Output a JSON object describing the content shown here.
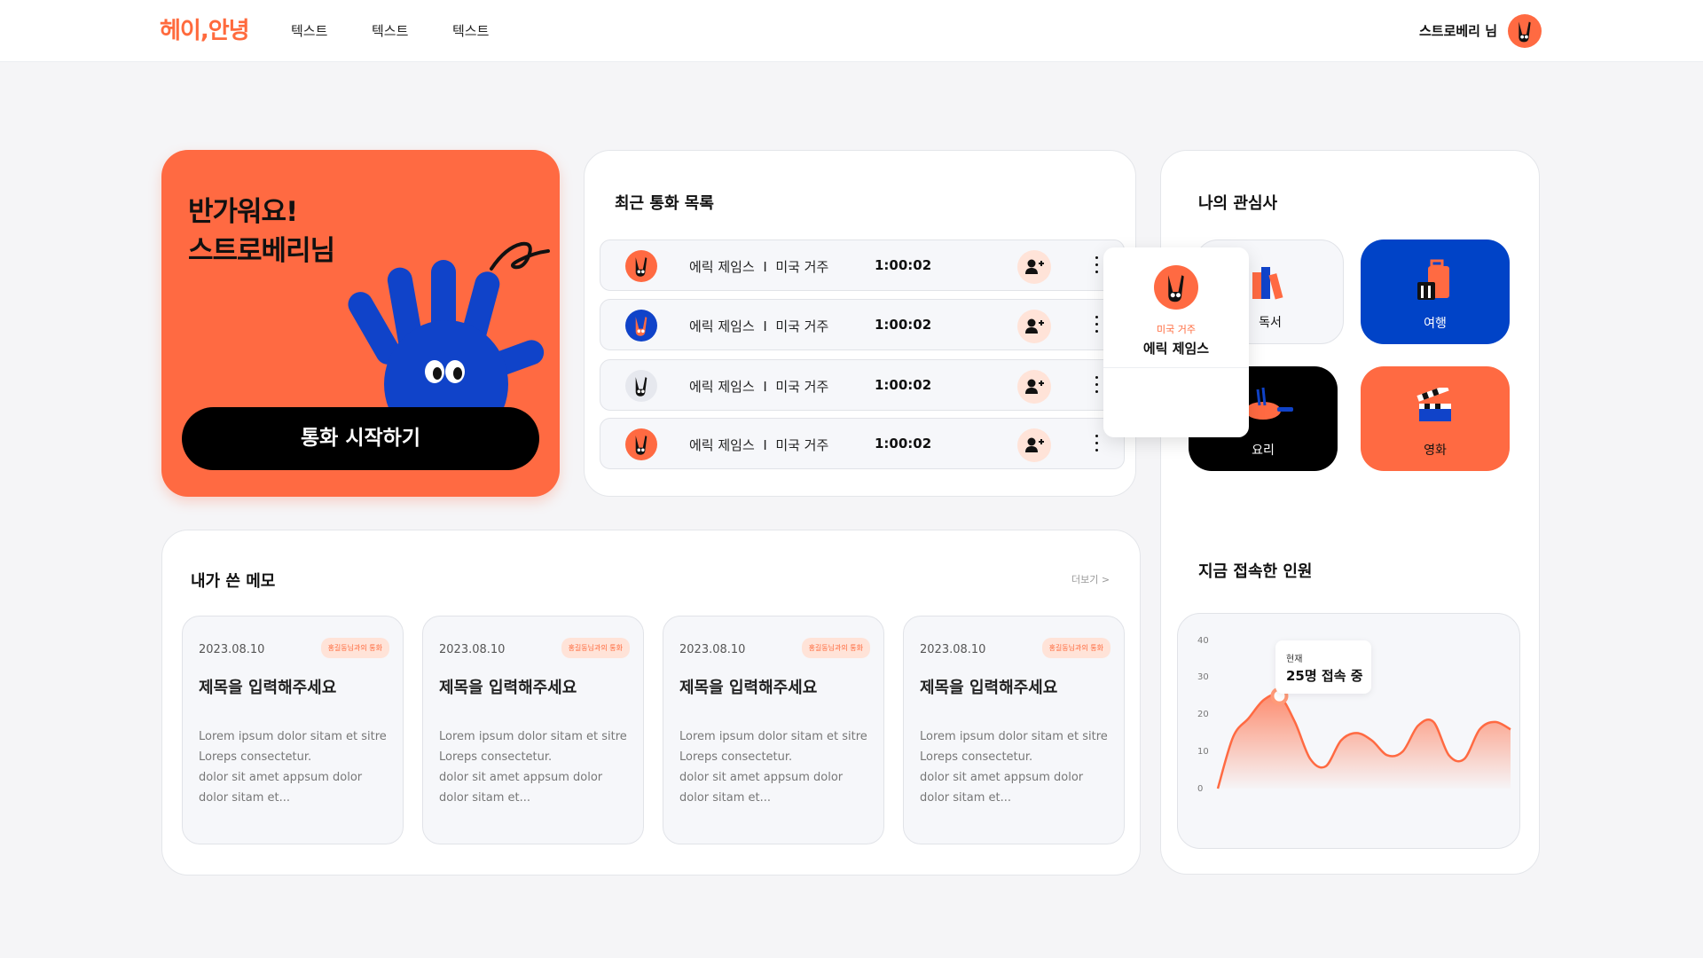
{
  "header": {
    "logo": "헤이,안녕",
    "nav": [
      "텍스트",
      "텍스트",
      "텍스트"
    ],
    "user_name": "스트로베리 님"
  },
  "welcome": {
    "line1": "반가워요!",
    "line2": "스트로베리님",
    "button": "통화 시작하기"
  },
  "calls": {
    "title": "최근 통화 목록",
    "items": [
      {
        "name": "에릭 제임스",
        "separator": "I",
        "location": "미국 거주",
        "duration": "1:00:02",
        "avatar_bg": "#ff6a42"
      },
      {
        "name": "에릭 제임스",
        "separator": "I",
        "location": "미국 거주",
        "duration": "1:00:02",
        "avatar_bg": "#1043c9"
      },
      {
        "name": "에릭 제임스",
        "separator": "I",
        "location": "미국 거주",
        "duration": "1:00:02",
        "avatar_bg": "#e6e8ee"
      },
      {
        "name": "에릭 제임스",
        "separator": "I",
        "location": "미국 거주",
        "duration": "1:00:02",
        "avatar_bg": "#ff6a42"
      }
    ]
  },
  "popup": {
    "location": "미국 거주",
    "name": "에릭 제임스"
  },
  "interests": {
    "title": "나의 관심사",
    "items": [
      {
        "label": "독서",
        "bg": "#f6f7fa",
        "icon": "books-icon"
      },
      {
        "label": "여행",
        "bg": "#0043c7",
        "icon": "luggage-icon"
      },
      {
        "label": "요리",
        "bg": "#000000",
        "icon": "cooking-pan-icon"
      },
      {
        "label": "영화",
        "bg": "#ff6a42",
        "icon": "clapperboard-icon"
      }
    ]
  },
  "memos": {
    "title": "내가 쓴 메모",
    "more": "더보기 >",
    "items": [
      {
        "date": "2023.08.10",
        "tag": "홍길동님과의 통화",
        "title": "제목을 입력해주세요",
        "body": [
          "Lorem ipsum dolor sitam et sitre",
          "Loreps consectetur.",
          "dolor sit amet appsum dolor",
          "dolor sitam et..."
        ]
      },
      {
        "date": "2023.08.10",
        "tag": "홍길동님과의 통화",
        "title": "제목을 입력해주세요",
        "body": [
          "Lorem ipsum dolor sitam et sitre",
          "Loreps consectetur.",
          "dolor sit amet appsum dolor",
          "dolor sitam et..."
        ]
      },
      {
        "date": "2023.08.10",
        "tag": "홍길동님과의 통화",
        "title": "제목을 입력해주세요",
        "body": [
          "Lorem ipsum dolor sitam et sitre",
          "Loreps consectetur.",
          "dolor sit amet appsum dolor",
          "dolor sitam et..."
        ]
      },
      {
        "date": "2023.08.10",
        "tag": "홍길동님과의 통화",
        "title": "제목을 입력해주세요",
        "body": [
          "Lorem ipsum dolor sitam et sitre",
          "Loreps consectetur.",
          "dolor sit amet appsum dolor",
          "dolor sitam et..."
        ]
      }
    ]
  },
  "online": {
    "title": "지금 접속한 인원",
    "tooltip_label": "현재",
    "tooltip_value": "25명 접속 중"
  },
  "chart_data": {
    "type": "area",
    "title": "",
    "ylim": [
      0,
      40
    ],
    "y_ticks": [
      "0",
      "10",
      "20",
      "30",
      "40"
    ],
    "values": [
      0,
      14,
      19,
      24,
      25,
      18,
      8,
      6,
      13,
      15,
      13,
      9,
      10,
      17,
      18,
      9,
      8,
      16,
      18,
      16
    ]
  },
  "colors": {
    "accent": "#ff6a42",
    "blue": "#0043c7"
  }
}
